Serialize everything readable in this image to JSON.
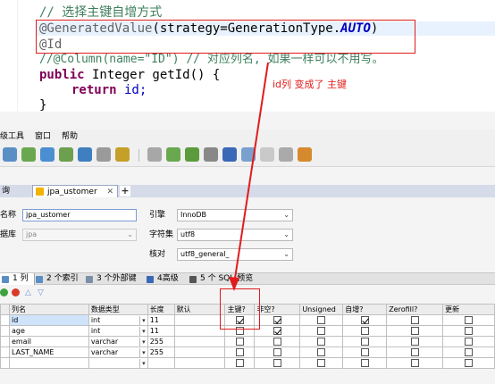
{
  "code": {
    "line1_comment": "// 选择主键自增方式",
    "line2_anno": "@GeneratedValue",
    "line2_args": "(strategy=GenerationType.",
    "line2_const": "AUTO",
    "line2_close": ")",
    "line3_anno": "@Id",
    "line4_comment": "//@Column(name=\"ID\") // 对应列名, 如果一样可以不用写。",
    "line5_kw": "public",
    "line5_rest": " Integer getId() {",
    "line6_kw": "return",
    "line6_rest": " id;",
    "line7": "}"
  },
  "annotation": "id列 变成了 主键",
  "colors": {
    "annotation": "#e01c1c",
    "selected_row": "#cfe3fb",
    "tab_strip": "#d6dbe9"
  },
  "menu": [
    "级工具",
    "窗口",
    "帮助"
  ],
  "toolbar_icons": [
    "new-icon",
    "open-icon",
    "refresh-icon",
    "link-icon",
    "export-icon",
    "import-icon",
    "doc-icon",
    "schema-icon",
    "sync-icon",
    "compare-icon",
    "backup-icon",
    "restore-icon",
    "users-icon",
    "grid-icon",
    "search-icon",
    "history-icon"
  ],
  "tabs": {
    "side_label": "询",
    "active_label": "jpa_ustomer",
    "close": "✕",
    "add": "+"
  },
  "form": {
    "table_name_label": "名称",
    "table_name_value": "jpa_ustomer",
    "db_label": "据库",
    "db_value": "jpa",
    "engine_label": "引擎",
    "engine_value": "InnoDB",
    "charset_label": "字符集",
    "charset_value": "utf8",
    "collation_label": "核对",
    "collation_value": "utf8_general_"
  },
  "subtabs": [
    {
      "label": "1 列"
    },
    {
      "label": "2 个索引"
    },
    {
      "label": "3 个外部键"
    },
    {
      "label": "4高级"
    },
    {
      "label": "5 个 SQL 预览"
    }
  ],
  "grid": {
    "headers": [
      "列名",
      "数据类型",
      "长度",
      "默认",
      "主键?",
      "非空?",
      "Unsigned",
      "自增?",
      "Zerofill?",
      "更新"
    ],
    "rows": [
      {
        "name": "id",
        "type": "int",
        "length": "11",
        "default": "",
        "pk": true,
        "notnull": true,
        "unsigned": false,
        "autoinc": true,
        "zerofill": false,
        "update": false,
        "selected": true
      },
      {
        "name": "age",
        "type": "int",
        "length": "11",
        "default": "",
        "pk": false,
        "notnull": true,
        "unsigned": false,
        "autoinc": false,
        "zerofill": false,
        "update": false,
        "selected": false
      },
      {
        "name": "email",
        "type": "varchar",
        "length": "255",
        "default": "",
        "pk": false,
        "notnull": false,
        "unsigned": false,
        "autoinc": false,
        "zerofill": false,
        "update": false,
        "selected": false
      },
      {
        "name": "LAST_NAME",
        "type": "varchar",
        "length": "255",
        "default": "",
        "pk": false,
        "notnull": false,
        "unsigned": false,
        "autoinc": false,
        "zerofill": false,
        "update": false,
        "selected": false
      },
      {
        "name": "",
        "type": "",
        "length": "",
        "default": "",
        "pk": false,
        "notnull": false,
        "unsigned": false,
        "autoinc": false,
        "zerofill": false,
        "update": false,
        "selected": false
      }
    ]
  }
}
